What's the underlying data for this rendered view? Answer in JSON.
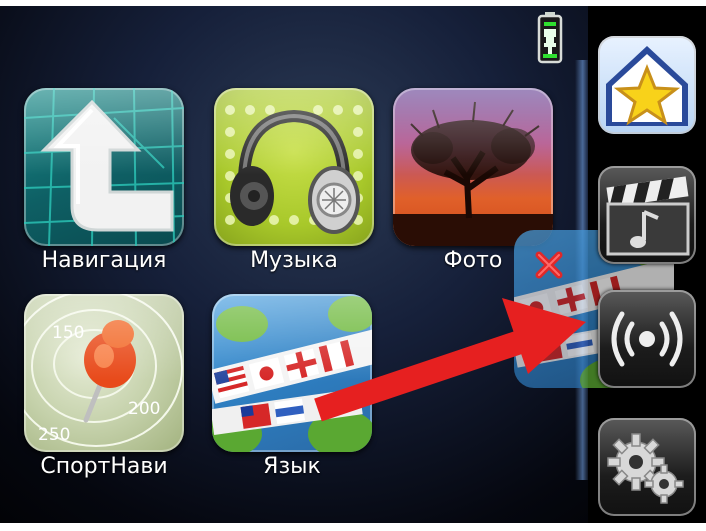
{
  "apps": [
    {
      "label": "Навигация"
    },
    {
      "label": "Музыка"
    },
    {
      "label": "Фото"
    },
    {
      "label": "СпортНави",
      "marks": [
        "150",
        "200",
        "250"
      ]
    },
    {
      "label": "Язык"
    }
  ],
  "sidebar": {
    "buttons": [
      {
        "name": "home-favorite-button",
        "icon": "star-icon"
      },
      {
        "name": "media-button",
        "icon": "clapperboard-icon"
      },
      {
        "name": "wireless-button",
        "icon": "wireless-signal-icon"
      },
      {
        "name": "settings-button",
        "icon": "gears-icon"
      }
    ]
  },
  "status": {
    "battery_icon": "battery-charging-icon"
  },
  "annotation": {
    "arrow_color": "#e62020"
  },
  "drag_ghost": {
    "icon": "language-flags-icon",
    "delete_icon": "close-icon",
    "delete_color": "#e02828"
  }
}
